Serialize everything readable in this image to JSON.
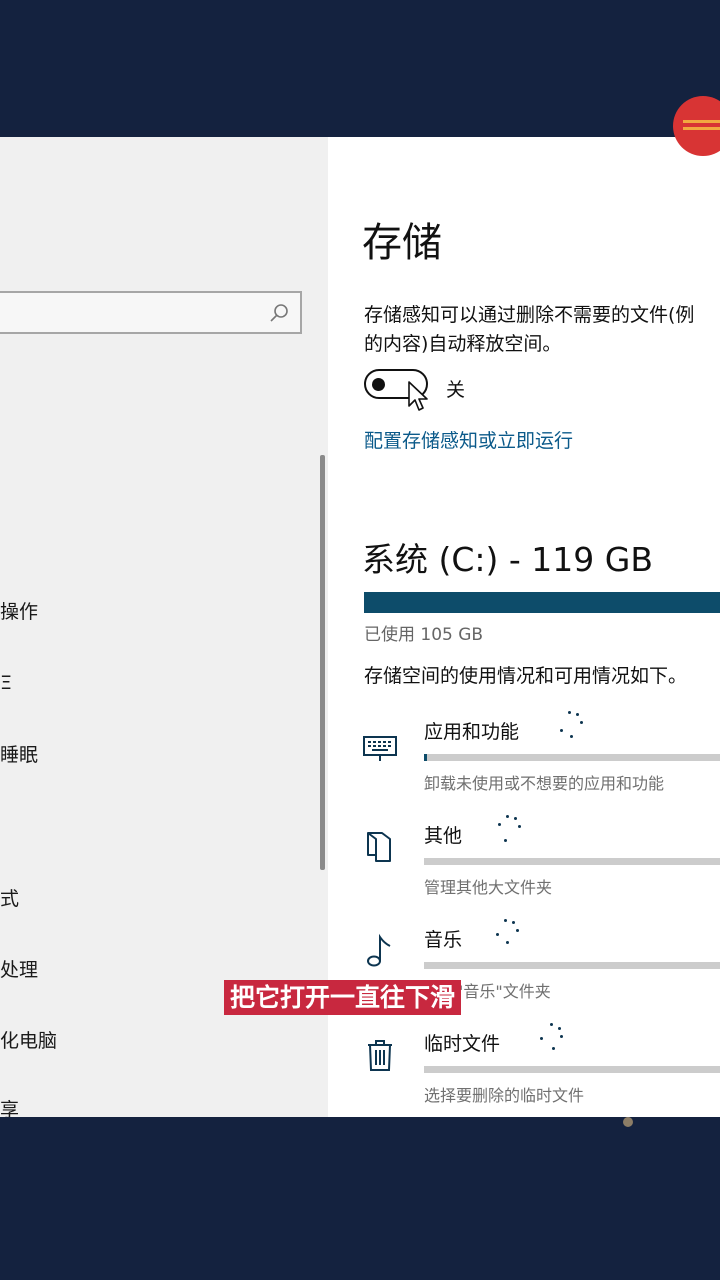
{
  "nav": {
    "items": [
      "操作",
      "Ξ",
      "睡眠",
      "式",
      "处理",
      "化电脑",
      "享"
    ]
  },
  "storage": {
    "title": "存储",
    "description_line1": "存储感知可以通过删除不需要的文件(例",
    "description_line2": "的内容)自动释放空间。",
    "toggle_state": "关",
    "configure_link": "配置存储感知或立即运行"
  },
  "drive": {
    "title": "系统 (C:) - 119 GB",
    "used": "已使用 105 GB",
    "used_fraction": 0.88,
    "usage_description": "存储空间的使用情况和可用情况如下。"
  },
  "categories": [
    {
      "name": "应用和功能",
      "description": "卸载未使用或不想要的应用和功能",
      "icon": "keyboard-icon",
      "fill": 0.01
    },
    {
      "name": "其他",
      "description": "管理其他大文件夹",
      "icon": "folder-icon",
      "fill": 0.0
    },
    {
      "name": "音乐",
      "description": "管理\"音乐\"文件夹",
      "icon": "music-note-icon",
      "fill": 0.0
    },
    {
      "name": "临时文件",
      "description": "选择要删除的临时文件",
      "icon": "trash-icon",
      "fill": 0.0
    }
  ],
  "caption": "把它打开一直往下滑",
  "colors": {
    "accent": "#0d4c6a",
    "link": "#0b5a8a",
    "caption_bg": "#c8283f",
    "background": "#14223f"
  }
}
